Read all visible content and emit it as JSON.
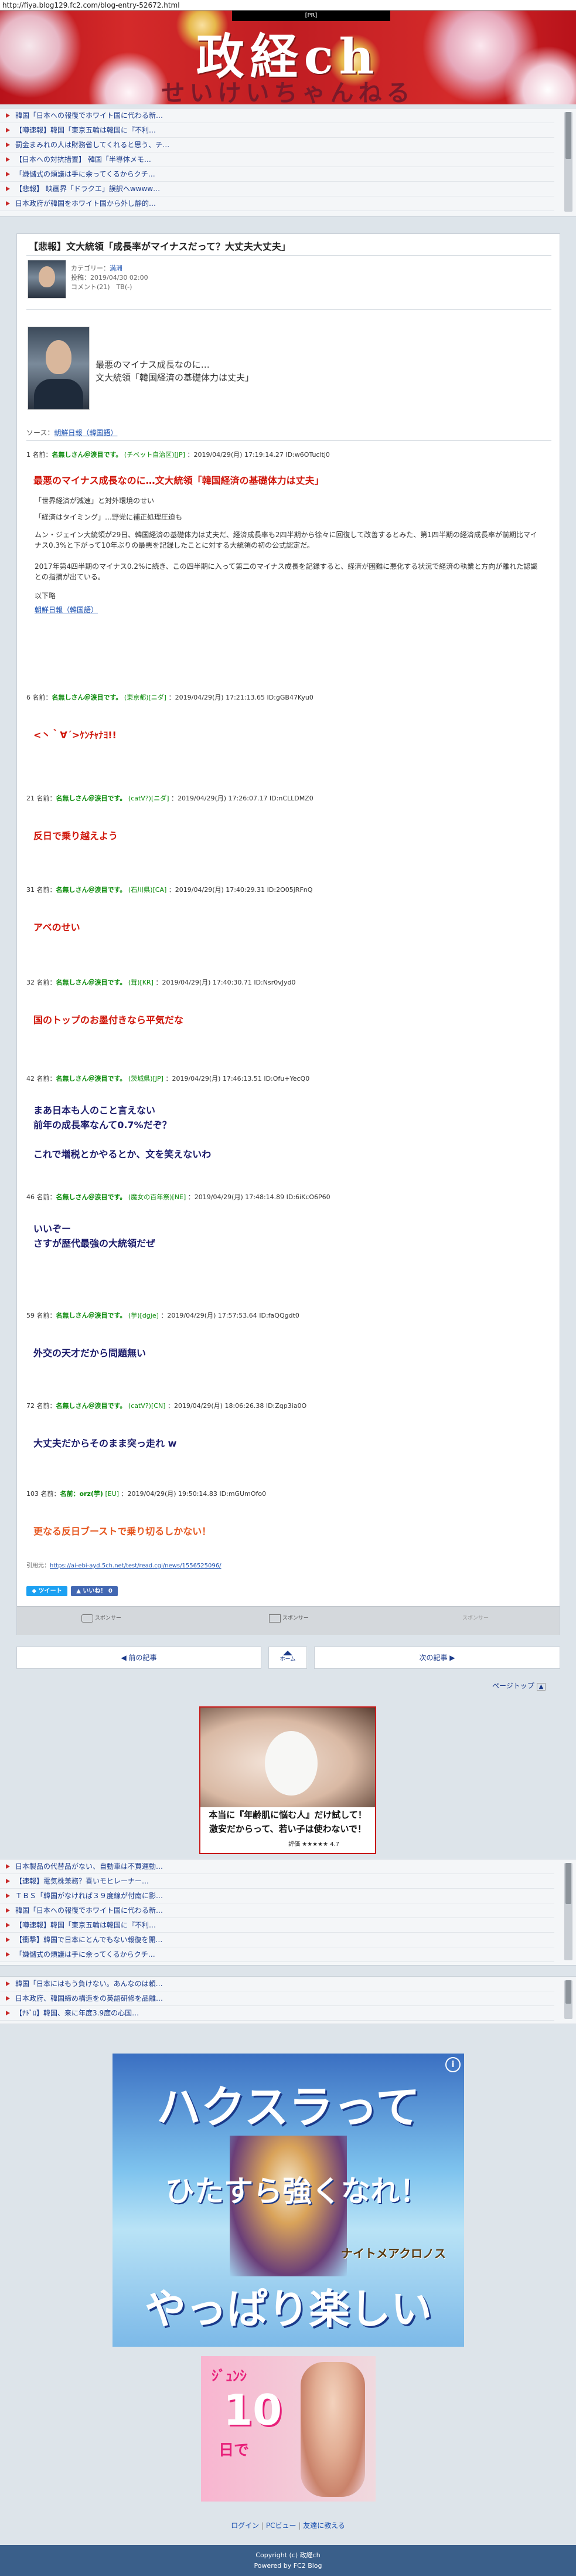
{
  "url": "http://fiya.blog129.fc2.com/blog-entry-52672.html",
  "banner": {
    "title": "政経ch",
    "subtitle": "せいけいちゃんねる",
    "ad_label": "[PR]"
  },
  "rss_top": [
    "韓国「日本への報復でホワイト国に代わる新…",
    "【噂速報】韓国「東京五輪は韓国に『不利…",
    "罰金まみれの人は財務省してくれると思う、チ…",
    "【日本への対抗措置】 韓国「半導体メモ…",
    "「嫌儲式の煩議は手に余ってくるからクチ…",
    "【悲報】 映画界「ドラクエ」誤訳へwwww…",
    "日本政府が韓国をホワイト国から外し静的…"
  ],
  "article": {
    "title": "【悲報】文大統領「成長率がマイナスだって？大丈夫大丈夫」",
    "category_label": "カテゴリー：",
    "category": "満洲",
    "posted": "投稿：2019/04/30 02:00",
    "comments": "コメント(21)　TB(-)",
    "intro_lines": [
      "最悪のマイナス成長なのに…",
      "文大統領「韓国経済の基礎体力は丈夫」"
    ],
    "source_label": "ソース：",
    "source_link": "朝鮮日報（韓国語）",
    "responses": [
      {
        "num": "1",
        "name": "名無しさん＠涙目です。",
        "extra": "(チベット自治区)",
        "id": "[JP]",
        "date": "2019/04/29(月) 17:19:14.27 ID:w6OTucltj0"
      },
      {
        "num": "6",
        "name": "名無しさん＠涙目です。",
        "extra": "(東京都)",
        "id": "[ニダ]",
        "date": "2019/04/29(月) 17:21:13.65 ID:gGB47Kyu0",
        "text": "<丶｀∀´>ｹﾝﾁｬﾅﾖ!!",
        "color": "red"
      },
      {
        "num": "21",
        "name": "名無しさん＠涙目です。",
        "extra": "(catV?)",
        "id": "[ニダ]",
        "date": "2019/04/29(月) 17:26:07.17 ID:nCLLDMZ0",
        "text": "反日で乗り越えよう",
        "color": "red"
      },
      {
        "num": "31",
        "name": "名無しさん＠涙目です。",
        "extra": "(石川県)",
        "id": "[CA]",
        "date": "2019/04/29(月) 17:40:29.31 ID:2O05jRFnQ",
        "text": "アベのせい",
        "color": "red"
      },
      {
        "num": "32",
        "name": "名無しさん＠涙目です。",
        "extra": "(茸)",
        "id": "[KR]",
        "date": "2019/04/29(月) 17:40:30.71 ID:Nsr0vJyd0",
        "text": "国のトップのお墨付きなら平気だな",
        "color": "red"
      },
      {
        "num": "42",
        "name": "名無しさん＠涙目です。",
        "extra": "(茨城県)",
        "id": "[JP]",
        "date": "2019/04/29(月) 17:46:13.51 ID:Ofu+YecQ0",
        "text_lines": [
          "まあ日本も人のこと言えない",
          "前年の成長率なんて0.7%だぞ？",
          "",
          "これで増税とかやるとか、文を笑えないわ"
        ],
        "color": "navy"
      },
      {
        "num": "46",
        "name": "名無しさん＠涙目です。",
        "extra": "(魔女の百年祭)",
        "id": "[NE]",
        "date": "2019/04/29(月) 17:48:14.89 ID:6iKcO6P60",
        "text_lines": [
          "いいぞー",
          "さすが歴代最強の大統領だぜ"
        ],
        "color": "navy"
      },
      {
        "num": "59",
        "name": "名無しさん＠涙目です。",
        "extra": "(芋)",
        "id": "[dgje]",
        "date": "2019/04/29(月) 17:57:53.64 ID:faQQgdt0",
        "text": "外交の天才だから問題無い",
        "color": "navy"
      },
      {
        "num": "72",
        "name": "名無しさん＠涙目です。",
        "extra": "(catV?)",
        "id": "[CN]",
        "date": "2019/04/29(月) 18:06:26.38 ID:Zqp3ia0O",
        "text": "大丈夫だからそのまま突っ走れ w",
        "color": "navy"
      },
      {
        "num": "103",
        "name": "名前：orz(芋)",
        "extra": "",
        "id": "[EU]",
        "date": "2019/04/29(月) 19:50:14.83 ID:mGUmOfo0",
        "text": "更なる反日ブーストで乗り切るしかない！",
        "color": "orange"
      }
    ],
    "res1_headline": "最悪のマイナス成長なのに…文大統領「韓国経済の基礎体力は丈夫」",
    "res1_body": [
      "「世界経済が減速」と対外環境のせい",
      "「経済はタイミング」…野党に補正処理圧迫も",
      "ムン・ジェイン大統領が29日、韓国経済の基礎体力は丈夫だ、経済成長率も2四半期から徐々に回復して改善するとみた、第1四半期の経済成長率が前期比マイナス0.3%と下がって10年ぶりの最悪を記録したことに対する大統領の初の公式認定だ。",
      "2017年第4四半期のマイナス0.2%に続き、この四半期に入って第二のマイナス成長を記録すると、経済が困難に悪化する状況で経済の執業と方向が離れた認識との指摘が出ている。"
    ],
    "res1_trail": "以下略",
    "res1_link": "朝鮮日報（韓国語）",
    "quote_source_label": "引用元：",
    "quote_source_link": "https://ai-ebi-ayd.5ch.net/test/read.cgi/news/1556525096/",
    "share_tweet": "ツイート",
    "share_like": "いいね！ 0",
    "actions": [
      "スポンサー",
      "スポンサー",
      "スポンサー"
    ]
  },
  "pager": {
    "prev": "前の記事",
    "home": "ホーム",
    "next": "次の記事",
    "top": "ページトップ"
  },
  "ad_skin": {
    "headline": "本当に『年齢肌に悩む人』だけ試して！",
    "sub": "激安だからって、若い子は使わないで！",
    "rating_label": "評価",
    "rating_value": "4.7"
  },
  "rss_mid": [
    "日本製品の代替品がない、自動車は不買運動…",
    "【速報】電気株兼務？喜いモヒレーナー…",
    "ＴＢＳ「韓国がなければ３９度線が付南に影…",
    "韓国「日本への報復でホワイト国に代わる新…",
    "【噂速報】韓国「東京五輪は韓国に『不利…",
    "【衝撃】韓国で日本にとんでもない報復を開…",
    "「嫌儲式の煩議は手に余ってくるからクチ…"
  ],
  "rss_bottom": [
    "韓国「日本にはもう負けない。あんなのは頼…",
    "日本政府、韓国締め構造をの英語研修を品離…",
    "【ﾅﾄﾞﾛ】韓国、来に年度3.9度の心国…"
  ],
  "ad_game": {
    "line1": "ハクスラって",
    "line2": "ひたすら強くなれ！",
    "logo": "ナイトメアクロノス",
    "line3": "やっぱり楽しい"
  },
  "ad_small": {
    "line1": "ｼﾞｭﾝｼ",
    "line2": "10",
    "line3": "日で"
  },
  "footer": {
    "links": [
      "ログイン",
      "PCビュー",
      "友達に教える"
    ],
    "copyright": "Copyright (c) 政経ch",
    "powered": "Powered by FC2 Blog"
  },
  "colors": {
    "accent_red": "#d0160a",
    "link_blue": "#1a50b0",
    "name_green": "#0a8a0a",
    "footer_blue": "#3a5f8a"
  }
}
